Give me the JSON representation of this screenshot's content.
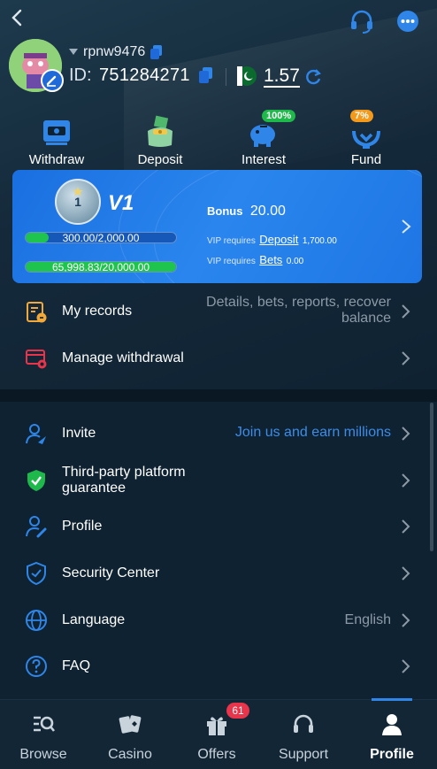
{
  "header": {
    "username": "rpnw9476",
    "id_label": "ID:",
    "id_value": "751284271",
    "balance": "1.57"
  },
  "quick_actions": [
    {
      "label": "Withdraw",
      "icon": "atm-icon"
    },
    {
      "label": "Deposit",
      "icon": "wallet-icon"
    },
    {
      "label": "Interest",
      "icon": "piggy-bank-icon",
      "badge": "100%"
    },
    {
      "label": "Fund",
      "icon": "fund-hands-icon",
      "badge": "7%"
    }
  ],
  "vip": {
    "level": "V1",
    "badge_number": "1",
    "progress_1_text": "300.00/2,000.00",
    "progress_1_fraction": 0.15,
    "progress_2_text": "65,998.83/20,000.00",
    "progress_2_fraction": 1.0,
    "bonus_label": "Bonus",
    "bonus_value": "20.00",
    "req1_prefix": "VIP requires",
    "req1_link": "Deposit",
    "req1_value": "1,700.00",
    "req2_prefix": "VIP requires",
    "req2_link": "Bets",
    "req2_value": "0.00"
  },
  "menu_top": [
    {
      "label": "My records",
      "hint": "Details, bets, reports, recover",
      "hint2": "balance"
    },
    {
      "label": "Manage withdrawal"
    }
  ],
  "menu_bottom": [
    {
      "label": "Invite",
      "hint": "Join us and earn millions"
    },
    {
      "label": "Third-party platform",
      "label2": "guarantee"
    },
    {
      "label": "Profile"
    },
    {
      "label": "Security Center"
    },
    {
      "label": "Language",
      "hint": "English"
    },
    {
      "label": "FAQ"
    }
  ],
  "bottom_nav": [
    {
      "label": "Browse"
    },
    {
      "label": "Casino"
    },
    {
      "label": "Offers",
      "badge": "61"
    },
    {
      "label": "Support"
    },
    {
      "label": "Profile",
      "active": true
    }
  ],
  "colors": {
    "accent_blue": "#2f86e8",
    "hint_blue": "#3d8ce8",
    "progress_green": "#1fc44f",
    "badge_red": "#e8354b",
    "background": "#0f2232"
  }
}
